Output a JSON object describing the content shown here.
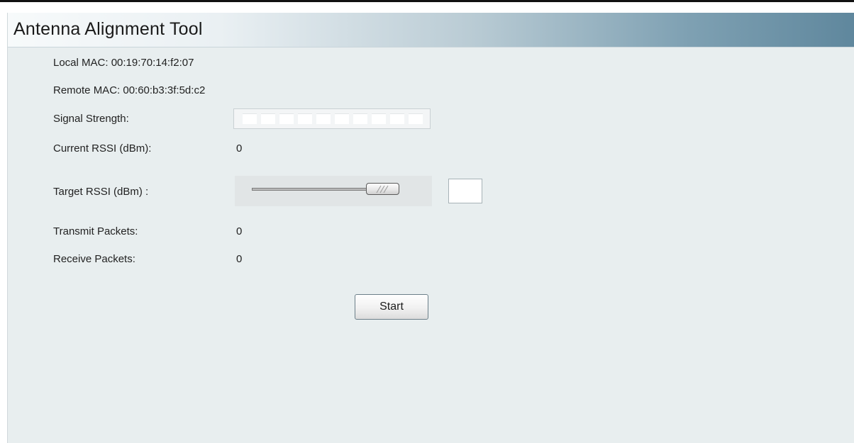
{
  "header": {
    "title": "Antenna Alignment Tool"
  },
  "fields": {
    "local_mac": "Local MAC: 00:19:70:14:f2:07",
    "remote_mac": "Remote MAC: 00:60:b3:3f:5d:c2",
    "signal_strength_label": "Signal Strength:",
    "signal_strength_level": 0,
    "signal_segments_total": 10,
    "current_rssi_label": "Current RSSI (dBm):",
    "current_rssi_value": "0",
    "target_rssi_label": "Target RSSI (dBm) :",
    "target_rssi_slider_fraction": 0.92,
    "target_rssi_input_value": "",
    "transmit_packets_label": "Transmit Packets:",
    "transmit_packets_value": "0",
    "receive_packets_label": "Receive Packets:",
    "receive_packets_value": "0"
  },
  "actions": {
    "start_label": "Start"
  },
  "colors": {
    "panel_background": "#e8eeef",
    "header_gradient_start": "#f7fafb",
    "header_gradient_end": "#5f879d"
  }
}
